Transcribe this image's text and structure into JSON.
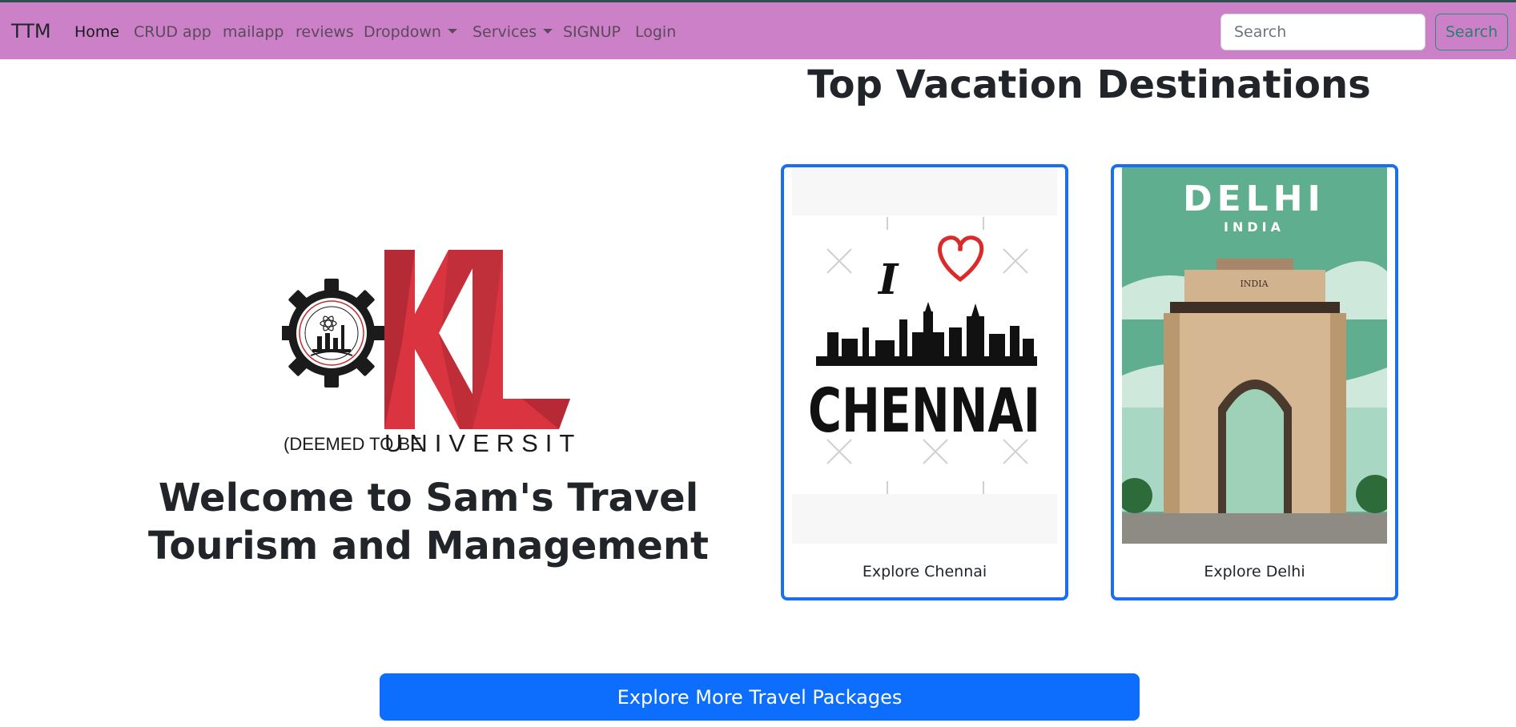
{
  "navbar": {
    "brand": "TTM",
    "items": [
      {
        "label": "Home"
      },
      {
        "label": "CRUD app"
      },
      {
        "label": "mailapp"
      },
      {
        "label": "reviews"
      },
      {
        "label": "Dropdown"
      },
      {
        "label": "Services"
      },
      {
        "label": "SIGNUP"
      },
      {
        "label": "Login"
      }
    ],
    "search": {
      "placeholder": "Search",
      "button_label": "Search"
    }
  },
  "hero": {
    "logo": {
      "letters": "KL",
      "line1": "(DEEMED TO BE",
      "line2": "UNIVERSITY)"
    },
    "welcome": "Welcome to Sam's Travel Tourism and Management"
  },
  "destinations": {
    "title": "Top Vacation Destinations",
    "cards": [
      {
        "city_art": "CHENNAI",
        "art_prefix": "I",
        "caption": "Explore Chennai"
      },
      {
        "city_art": "DELHI",
        "art_sub": "INDIA",
        "gate_text": "INDIA",
        "caption": "Explore Delhi"
      }
    ]
  },
  "cta": {
    "label": "Explore More Travel Packages"
  },
  "colors": {
    "navbar": "#cc80c8",
    "primary": "#0d6efd",
    "card_border": "#1a6ef0",
    "kl_red": "#d9343f"
  }
}
